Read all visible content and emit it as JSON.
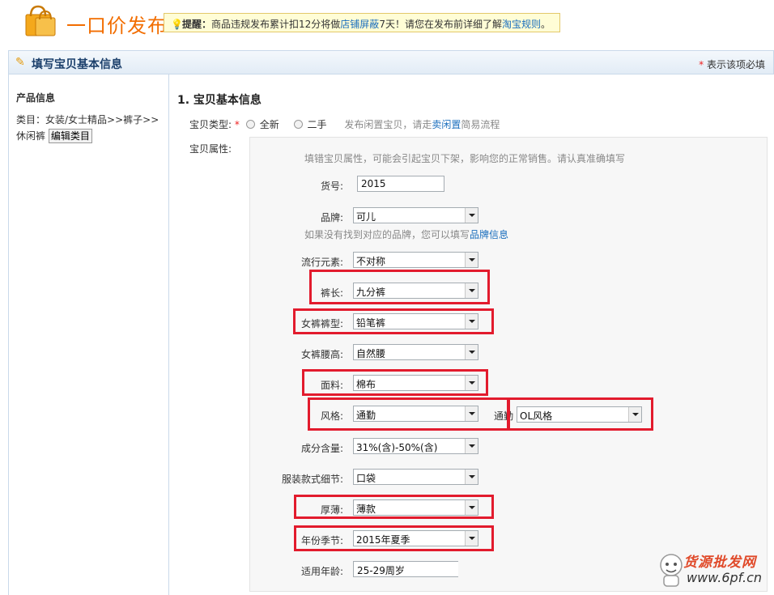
{
  "header": {
    "title": "一口价发布",
    "notice": {
      "label": "提醒：",
      "text_before": "商品违规发布累计扣12分将做",
      "link1": "店铺屏蔽",
      "text_middle": "7天！请您在发布前详细了解",
      "link2": "淘宝规则",
      "text_after": "。"
    }
  },
  "section": {
    "title": "填写宝贝基本信息",
    "required_note": "表示该项必填",
    "required_star": "*"
  },
  "sidebar": {
    "heading": "产品信息",
    "category_path": "类目：女装/女士精品>>裤子>>休闲裤",
    "edit_button": "编辑类目"
  },
  "main": {
    "section_title": "1. 宝贝基本信息",
    "item_type": {
      "label": "宝贝类型:",
      "star": "*",
      "option_new": "全新",
      "option_used": "二手",
      "hint_before": "发布闲置宝贝，请走",
      "hint_link": "卖闲置",
      "hint_after": "简易流程"
    },
    "attr_label": "宝贝属性:",
    "attr_warning": "填错宝贝属性，可能会引起宝贝下架，影响您的正常销售。请认真准确填写",
    "brand_hint_before": "如果没有找到对应的品牌，您可以填写",
    "brand_hint_link": "品牌信息",
    "fields": {
      "huohao": {
        "label": "货号:",
        "value": "2015"
      },
      "brand": {
        "label": "品牌:",
        "value": "可儿"
      },
      "liuxing": {
        "label": "流行元素:",
        "value": "不对称"
      },
      "kuchang": {
        "label": "裤长:",
        "value": "九分裤"
      },
      "kuxing": {
        "label": "女裤裤型:",
        "value": "铅笔裤"
      },
      "yaogao": {
        "label": "女裤腰高:",
        "value": "自然腰"
      },
      "mianliao": {
        "label": "面料:",
        "value": "棉布"
      },
      "fengge": {
        "label": "风格:",
        "value": "通勤",
        "sub_label": "通勤",
        "sub_value": "OL风格"
      },
      "chengfen": {
        "label": "成分含量:",
        "value": "31%(含)-50%(含)"
      },
      "xijie": {
        "label": "服装款式细节:",
        "value": "口袋"
      },
      "houbao": {
        "label": "厚薄:",
        "value": "薄款"
      },
      "jijie": {
        "label": "年份季节:",
        "value": "2015年夏季"
      },
      "nianling": {
        "label": "适用年龄:",
        "value": "25-29周岁"
      }
    }
  },
  "watermark": {
    "line1": "货源批发网",
    "line2": "www.6pf.cn"
  },
  "colors": {
    "title_orange": "#f26d00",
    "highlight_red": "#e21b2d",
    "link_blue": "#1a6ebd"
  }
}
